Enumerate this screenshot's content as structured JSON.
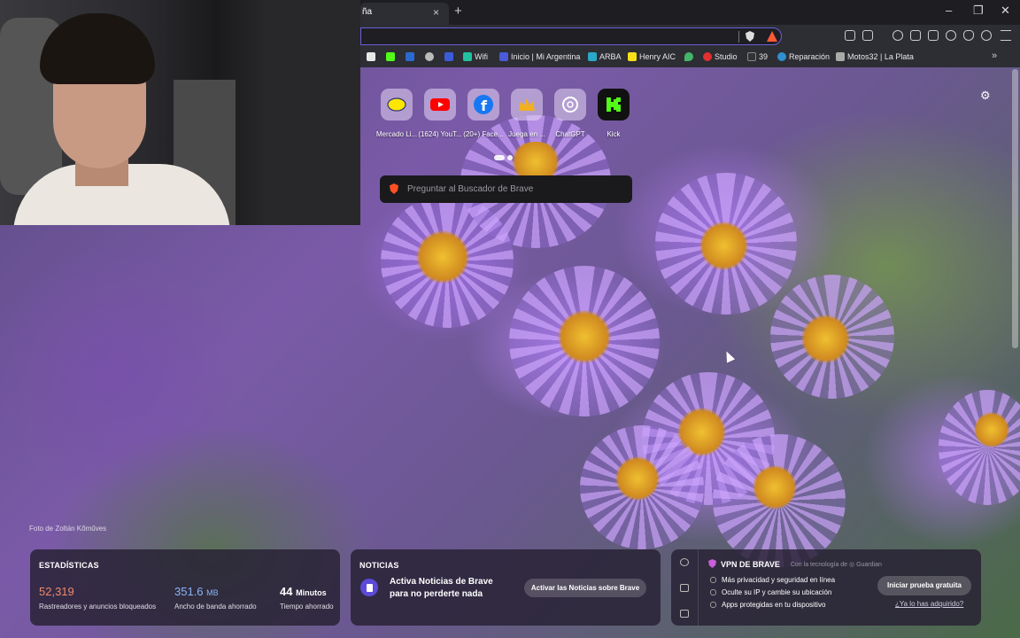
{
  "browser": {
    "tab_title": "ña",
    "tab_close": "×",
    "new_tab": "+",
    "window_controls": [
      "–",
      "❐",
      "✕"
    ],
    "vpn_badge_count": "1"
  },
  "bookmarks": [
    {
      "label": "",
      "icon": "amazon-icon",
      "color": "#e8e8e8"
    },
    {
      "label": "",
      "icon": "kick-icon",
      "color": "#53fc18"
    },
    {
      "label": "",
      "icon": "app-icon",
      "color": "#2a6ad0"
    },
    {
      "label": "",
      "icon": "globe-icon",
      "color": "#bbbbbb"
    },
    {
      "label": "",
      "icon": "bank-icon",
      "color": "#3b5bd9"
    },
    {
      "label": "Wifi",
      "icon": "wifi-icon",
      "color": "#22c0a0"
    },
    {
      "label": "Inicio | Mi Argentina",
      "icon": "argentina-icon",
      "color": "#4a5ad8"
    },
    {
      "label": "ARBA",
      "icon": "arba-icon",
      "color": "#29a8c9"
    },
    {
      "label": "Henry AIC",
      "icon": "henry-icon",
      "color": "#f7e018"
    },
    {
      "label": "",
      "icon": "location-icon",
      "color": "#43b46a"
    },
    {
      "label": "Studio",
      "icon": "studio-icon",
      "color": "#e03030"
    },
    {
      "label": "39",
      "icon": "af-icon",
      "color": "#333333"
    },
    {
      "label": "Reparación",
      "icon": "repair-icon",
      "color": "#2f8fd0"
    },
    {
      "label": "Motos32 | La Plata",
      "icon": "moto-icon",
      "color": "#aaaaaa"
    }
  ],
  "bookmarks_more": "»",
  "tiles": [
    {
      "label": "Mercado Li...",
      "icon": "mercadolibre-icon",
      "color": "#ffe600"
    },
    {
      "label": "(1624) YouT...",
      "icon": "youtube-icon",
      "color": "#ff0000"
    },
    {
      "label": "(20+) Face...",
      "icon": "facebook-icon",
      "color": "#1877f2"
    },
    {
      "label": "Juega en ...",
      "icon": "crown-icon",
      "color": "#f0b020"
    },
    {
      "label": "ChatGPT",
      "icon": "chatgpt-icon",
      "color": "#ffffff"
    },
    {
      "label": "Kick",
      "icon": "kick-icon",
      "color": "#53fc18"
    }
  ],
  "search": {
    "placeholder": "Preguntar al Buscador de Brave"
  },
  "photo_credit": "Foto de Zoltán Kőműves",
  "stats": {
    "title": "ESTADÍSTICAS",
    "trackers": {
      "value": "52,319",
      "desc": "Rastreadores y anuncios bloqueados",
      "color": "#f08a6a"
    },
    "bandwidth": {
      "value": "351.6",
      "unit": "MB",
      "desc": "Ancho de banda ahorrado",
      "color": "#8ab4f8"
    },
    "time": {
      "value": "44",
      "unit": "Minutos",
      "desc": "Tiempo ahorrado",
      "color": "#ffffff"
    }
  },
  "news": {
    "title": "NOTICIAS",
    "text": "Activa Noticias de Brave para no perderte nada",
    "button": "Activar las Noticias sobre Brave"
  },
  "vpn": {
    "title": "VPN DE BRAVE",
    "by": "Con la tecnología de ◎ Guardian",
    "features": [
      "Más privacidad y seguridad en línea",
      "Oculte su IP y cambie su ubicación",
      "Apps protegidas en tu dispositivo"
    ],
    "button": "Iniciar prueba gratuita",
    "link": "¿Ya lo has adquirido?"
  }
}
